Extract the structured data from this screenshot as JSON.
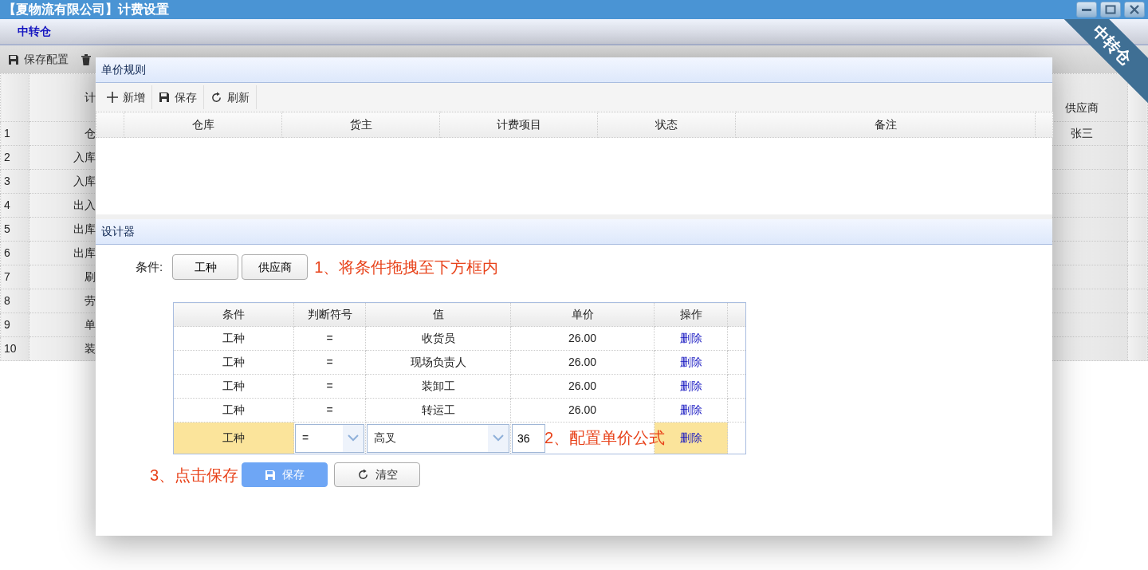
{
  "window": {
    "title": "【夏物流有限公司】计费设置"
  },
  "tabs": [
    {
      "label": "中转仓",
      "selected": true
    }
  ],
  "ribbon": {
    "label": "中转仓"
  },
  "toolbar": [
    {
      "kind": "save",
      "label": "保存配置"
    },
    {
      "kind": "delete"
    }
  ],
  "grid": {
    "column_2": "计",
    "supplier_column": "供应商",
    "rows": [
      {
        "number": "1",
        "column_2": "仓",
        "supplier": "张三"
      },
      {
        "number": "2",
        "column_2": "入库"
      },
      {
        "number": "3",
        "column_2": "入库"
      },
      {
        "number": "4",
        "column_2": "出入"
      },
      {
        "number": "5",
        "column_2": "出库"
      },
      {
        "number": "6",
        "column_2": "出库"
      },
      {
        "number": "7",
        "column_2": "刷"
      },
      {
        "number": "8",
        "column_2": "劳"
      },
      {
        "number": "9",
        "column_2": "单"
      },
      {
        "number": "10",
        "column_2": "装"
      }
    ]
  },
  "dialog": {
    "rules_panel": {
      "title": "单价规则",
      "toolbar": [
        {
          "kind": "add",
          "label": "新增"
        },
        {
          "kind": "save",
          "label": "保存"
        },
        {
          "kind": "refresh",
          "label": "刷新"
        }
      ],
      "columns": [
        "仓库",
        "货主",
        "计费项目",
        "状态",
        "备注"
      ]
    },
    "designer": {
      "title": "设计器",
      "conditions_label": "条件:",
      "conditions": [
        "工种",
        "供应商"
      ],
      "annotations": [
        "1、将条件拖拽至下方框内",
        "2、配置单价公式",
        "3、点击保存"
      ],
      "table": {
        "columns": [
          "条件",
          "判断符号",
          "值",
          "单价",
          "操作"
        ],
        "rows": [
          {
            "condition": "工种",
            "operator": "=",
            "value": "收货员",
            "price": "26.00",
            "action": "删除",
            "editing": false
          },
          {
            "condition": "工种",
            "operator": "=",
            "value": "现场负责人",
            "price": "26.00",
            "action": "删除",
            "editing": false
          },
          {
            "condition": "工种",
            "operator": "=",
            "value": "装卸工",
            "price": "26.00",
            "action": "删除",
            "editing": false
          },
          {
            "condition": "工种",
            "operator": "=",
            "value": "转运工",
            "price": "26.00",
            "action": "删除",
            "editing": false
          },
          {
            "condition": "工种",
            "operator": "=",
            "value": "高叉",
            "price": "36",
            "action": "删除",
            "editing": true
          }
        ]
      },
      "buttons": [
        {
          "kind": "primary",
          "label": "保存"
        },
        {
          "kind": "default",
          "label": "清空"
        }
      ]
    }
  }
}
